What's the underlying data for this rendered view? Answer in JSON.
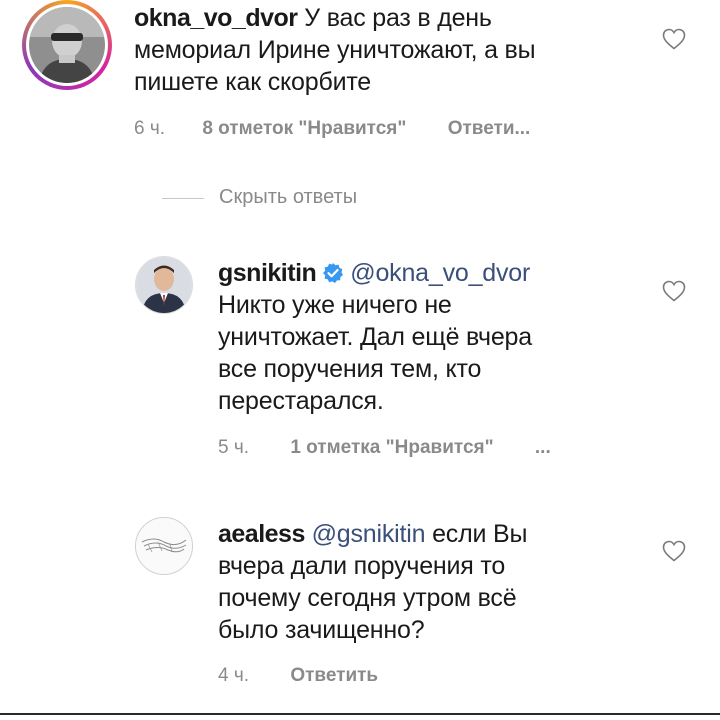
{
  "comments": [
    {
      "username": "okna_vo_dvor",
      "text_lines": [
        "У вас раз в день",
        "мемориал Ирине уничтожают, а вы",
        "пишете как скорбите"
      ],
      "time": "6 ч.",
      "likes": "8 отметок \"Нравится\"",
      "reply": "Ответи..."
    },
    {
      "username": "gsnikitin",
      "verified": true,
      "mention": "@okna_vo_dvor",
      "text_lines": [
        "Никто уже  ничего не",
        "уничтожает. Дал ещё вчера",
        "все поручения тем, кто",
        "перестарался."
      ],
      "time": "5 ч.",
      "likes": "1 отметка \"Нравится\"",
      "more": "..."
    },
    {
      "username": "aealess",
      "mention": "@gsnikitin",
      "text_first": "если Вы",
      "text_lines": [
        "вчера дали поручения то",
        "почему сегодня утром всё",
        "было зачищенно?"
      ],
      "time": "4 ч.",
      "reply": "Ответить"
    }
  ],
  "hide_replies": "Скрыть ответы",
  "colors": {
    "story_ring_start": "#f5a623",
    "story_ring_end": "#d6249f",
    "verified_badge": "#3897f0",
    "meta_text": "#8a8a8a",
    "mention": "#3a4f7a"
  },
  "icons": [
    "heart-outline-icon",
    "verified-badge-icon"
  ]
}
